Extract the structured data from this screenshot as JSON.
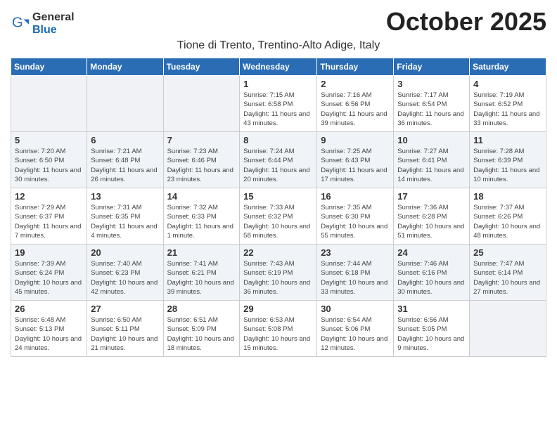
{
  "logo": {
    "general": "General",
    "blue": "Blue"
  },
  "header": {
    "month": "October 2025",
    "subtitle": "Tione di Trento, Trentino-Alto Adige, Italy"
  },
  "days_of_week": [
    "Sunday",
    "Monday",
    "Tuesday",
    "Wednesday",
    "Thursday",
    "Friday",
    "Saturday"
  ],
  "weeks": [
    [
      {
        "day": "",
        "info": ""
      },
      {
        "day": "",
        "info": ""
      },
      {
        "day": "",
        "info": ""
      },
      {
        "day": "1",
        "info": "Sunrise: 7:15 AM\nSunset: 6:58 PM\nDaylight: 11 hours and 43 minutes."
      },
      {
        "day": "2",
        "info": "Sunrise: 7:16 AM\nSunset: 6:56 PM\nDaylight: 11 hours and 39 minutes."
      },
      {
        "day": "3",
        "info": "Sunrise: 7:17 AM\nSunset: 6:54 PM\nDaylight: 11 hours and 36 minutes."
      },
      {
        "day": "4",
        "info": "Sunrise: 7:19 AM\nSunset: 6:52 PM\nDaylight: 11 hours and 33 minutes."
      }
    ],
    [
      {
        "day": "5",
        "info": "Sunrise: 7:20 AM\nSunset: 6:50 PM\nDaylight: 11 hours and 30 minutes."
      },
      {
        "day": "6",
        "info": "Sunrise: 7:21 AM\nSunset: 6:48 PM\nDaylight: 11 hours and 26 minutes."
      },
      {
        "day": "7",
        "info": "Sunrise: 7:23 AM\nSunset: 6:46 PM\nDaylight: 11 hours and 23 minutes."
      },
      {
        "day": "8",
        "info": "Sunrise: 7:24 AM\nSunset: 6:44 PM\nDaylight: 11 hours and 20 minutes."
      },
      {
        "day": "9",
        "info": "Sunrise: 7:25 AM\nSunset: 6:43 PM\nDaylight: 11 hours and 17 minutes."
      },
      {
        "day": "10",
        "info": "Sunrise: 7:27 AM\nSunset: 6:41 PM\nDaylight: 11 hours and 14 minutes."
      },
      {
        "day": "11",
        "info": "Sunrise: 7:28 AM\nSunset: 6:39 PM\nDaylight: 11 hours and 10 minutes."
      }
    ],
    [
      {
        "day": "12",
        "info": "Sunrise: 7:29 AM\nSunset: 6:37 PM\nDaylight: 11 hours and 7 minutes."
      },
      {
        "day": "13",
        "info": "Sunrise: 7:31 AM\nSunset: 6:35 PM\nDaylight: 11 hours and 4 minutes."
      },
      {
        "day": "14",
        "info": "Sunrise: 7:32 AM\nSunset: 6:33 PM\nDaylight: 11 hours and 1 minute."
      },
      {
        "day": "15",
        "info": "Sunrise: 7:33 AM\nSunset: 6:32 PM\nDaylight: 10 hours and 58 minutes."
      },
      {
        "day": "16",
        "info": "Sunrise: 7:35 AM\nSunset: 6:30 PM\nDaylight: 10 hours and 55 minutes."
      },
      {
        "day": "17",
        "info": "Sunrise: 7:36 AM\nSunset: 6:28 PM\nDaylight: 10 hours and 51 minutes."
      },
      {
        "day": "18",
        "info": "Sunrise: 7:37 AM\nSunset: 6:26 PM\nDaylight: 10 hours and 48 minutes."
      }
    ],
    [
      {
        "day": "19",
        "info": "Sunrise: 7:39 AM\nSunset: 6:24 PM\nDaylight: 10 hours and 45 minutes."
      },
      {
        "day": "20",
        "info": "Sunrise: 7:40 AM\nSunset: 6:23 PM\nDaylight: 10 hours and 42 minutes."
      },
      {
        "day": "21",
        "info": "Sunrise: 7:41 AM\nSunset: 6:21 PM\nDaylight: 10 hours and 39 minutes."
      },
      {
        "day": "22",
        "info": "Sunrise: 7:43 AM\nSunset: 6:19 PM\nDaylight: 10 hours and 36 minutes."
      },
      {
        "day": "23",
        "info": "Sunrise: 7:44 AM\nSunset: 6:18 PM\nDaylight: 10 hours and 33 minutes."
      },
      {
        "day": "24",
        "info": "Sunrise: 7:46 AM\nSunset: 6:16 PM\nDaylight: 10 hours and 30 minutes."
      },
      {
        "day": "25",
        "info": "Sunrise: 7:47 AM\nSunset: 6:14 PM\nDaylight: 10 hours and 27 minutes."
      }
    ],
    [
      {
        "day": "26",
        "info": "Sunrise: 6:48 AM\nSunset: 5:13 PM\nDaylight: 10 hours and 24 minutes."
      },
      {
        "day": "27",
        "info": "Sunrise: 6:50 AM\nSunset: 5:11 PM\nDaylight: 10 hours and 21 minutes."
      },
      {
        "day": "28",
        "info": "Sunrise: 6:51 AM\nSunset: 5:09 PM\nDaylight: 10 hours and 18 minutes."
      },
      {
        "day": "29",
        "info": "Sunrise: 6:53 AM\nSunset: 5:08 PM\nDaylight: 10 hours and 15 minutes."
      },
      {
        "day": "30",
        "info": "Sunrise: 6:54 AM\nSunset: 5:06 PM\nDaylight: 10 hours and 12 minutes."
      },
      {
        "day": "31",
        "info": "Sunrise: 6:56 AM\nSunset: 5:05 PM\nDaylight: 10 hours and 9 minutes."
      },
      {
        "day": "",
        "info": ""
      }
    ]
  ]
}
